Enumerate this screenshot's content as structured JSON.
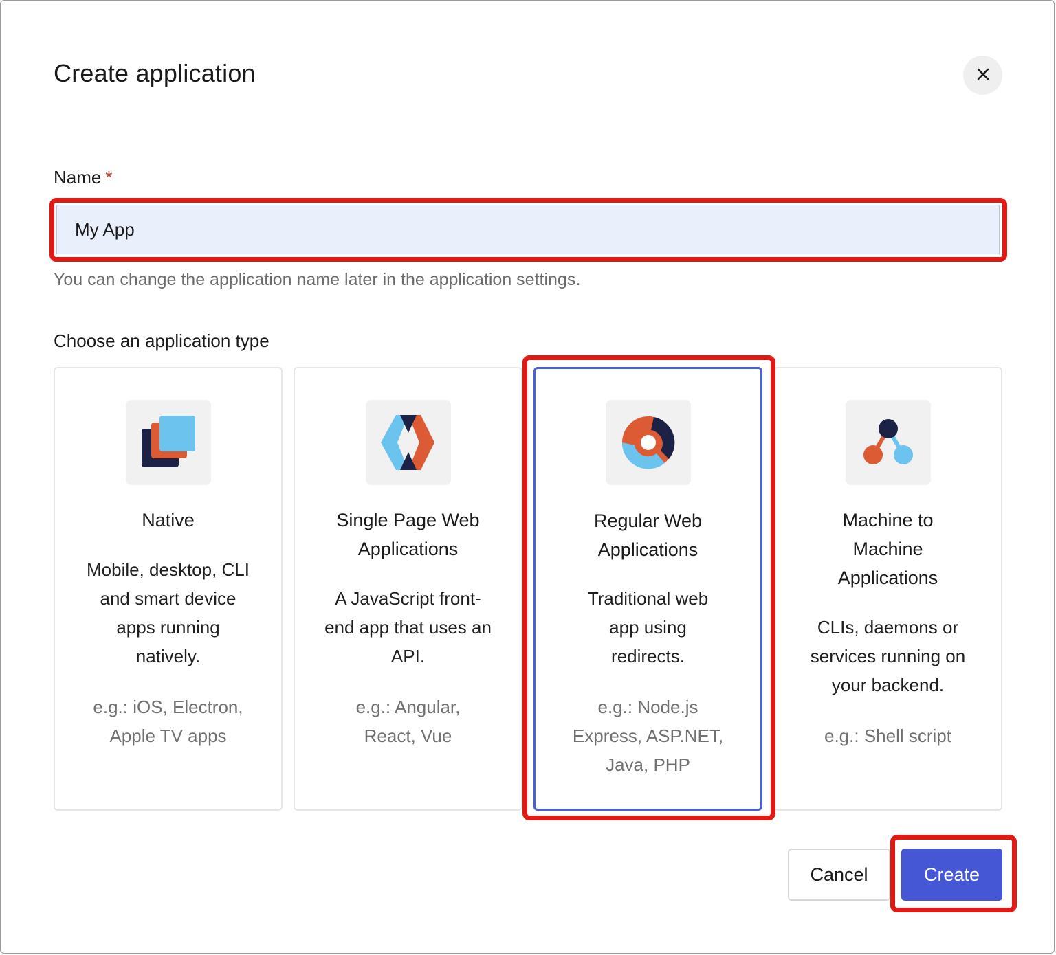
{
  "dialog": {
    "title": "Create application",
    "close_icon": "close-icon"
  },
  "name_field": {
    "label": "Name",
    "required_marker": "*",
    "value": "My App",
    "helper": "You can change the application name later in the application settings."
  },
  "app_types": {
    "label": "Choose an application type",
    "selected": "Regular Web Applications",
    "items": [
      {
        "icon": "native-app-icon",
        "title": "Native",
        "description": "Mobile, desktop, CLI and smart device apps running natively.",
        "examples": "e.g.: iOS, Electron, Apple TV apps"
      },
      {
        "icon": "single-page-app-icon",
        "title": "Single Page Web Applications",
        "description": "A JavaScript front-end app that uses an API.",
        "examples": "e.g.: Angular, React, Vue"
      },
      {
        "icon": "regular-web-app-icon",
        "title": "Regular Web Applications",
        "description": "Traditional web app using redirects.",
        "examples": "e.g.: Node.js Express, ASP.NET, Java, PHP"
      },
      {
        "icon": "machine-to-machine-icon",
        "title": "Machine to Machine Applications",
        "description": "CLIs, daemons or services running on your backend.",
        "examples": "e.g.: Shell script"
      }
    ]
  },
  "actions": {
    "cancel_label": "Cancel",
    "create_label": "Create"
  },
  "colors": {
    "primary": "#4657d6",
    "highlight": "#e11b14",
    "selected_border": "#4b5fd9",
    "input_bg": "#e9effb",
    "icon_navy": "#1c2146",
    "icon_orange": "#dc5b35",
    "icon_blue": "#6cc3ee"
  }
}
